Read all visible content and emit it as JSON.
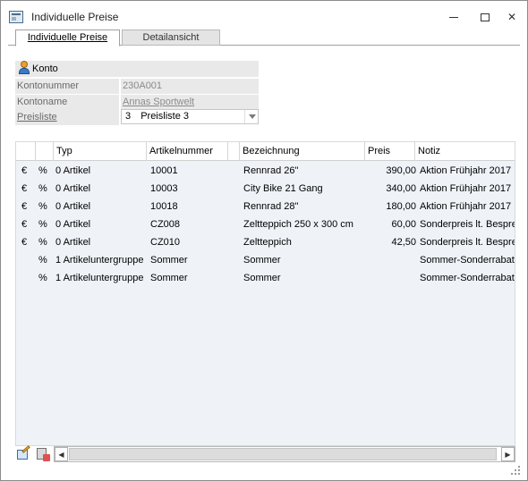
{
  "window": {
    "title": "Individuelle Preise"
  },
  "title_buttons": {
    "minimize": "",
    "maximize": "",
    "close": "✕"
  },
  "tabs": [
    {
      "label": "Individuelle Preise",
      "active": true
    },
    {
      "label": "Detailansicht",
      "active": false
    }
  ],
  "konto": {
    "section_title": "Konto",
    "fields": [
      {
        "label": "Kontonummer",
        "value": "230A001"
      },
      {
        "label": "Kontoname",
        "value": "Annas Sportwelt"
      }
    ],
    "preisliste": {
      "label": "Preisliste",
      "number": "3",
      "name": "Preisliste 3"
    }
  },
  "grid": {
    "columns": [
      "",
      "",
      "Typ",
      "Artikelnummer",
      "",
      "Bezeichnung",
      "Preis",
      "Notiz"
    ],
    "rows": [
      {
        "currency": "€",
        "percent": "%",
        "typ": "0 Artikel",
        "artikelnummer": "10001",
        "bezeichnung": "Rennrad 26\"",
        "preis": "390,00",
        "notiz": "Aktion Frühjahr 2017"
      },
      {
        "currency": "€",
        "percent": "%",
        "typ": "0 Artikel",
        "artikelnummer": "10003",
        "bezeichnung": "City Bike 21 Gang",
        "preis": "340,00",
        "notiz": "Aktion Frühjahr 2017"
      },
      {
        "currency": "€",
        "percent": "%",
        "typ": "0 Artikel",
        "artikelnummer": "10018",
        "bezeichnung": "Rennrad 28\"",
        "preis": "180,00",
        "notiz": "Aktion Frühjahr 2017"
      },
      {
        "currency": "€",
        "percent": "%",
        "typ": "0 Artikel",
        "artikelnummer": "CZ008",
        "bezeichnung": "Zeltteppich 250 x 300 cm",
        "preis": "60,00",
        "notiz": "Sonderpreis lt. Bespre"
      },
      {
        "currency": "€",
        "percent": "%",
        "typ": "0 Artikel",
        "artikelnummer": "CZ010",
        "bezeichnung": "Zeltteppich",
        "preis": "42,50",
        "notiz": "Sonderpreis lt. Bespre"
      },
      {
        "currency": "",
        "percent": "%",
        "typ": "1 Artikeluntergruppe",
        "artikelnummer": "Sommer",
        "bezeichnung": "Sommer",
        "preis": "",
        "notiz": "Sommer-Sonderrabatt"
      },
      {
        "currency": "",
        "percent": "%",
        "typ": "1 Artikeluntergruppe",
        "artikelnummer": "Sommer",
        "bezeichnung": "Sommer",
        "preis": "",
        "notiz": "Sommer-Sonderrabatt"
      }
    ]
  },
  "scrollbar": {
    "left_arrow": "◀",
    "right_arrow": "▶"
  },
  "icons": {
    "app": "window-app-icon",
    "konto": "user-icon",
    "edit": "edit-icon",
    "delete": "delete-icon"
  }
}
